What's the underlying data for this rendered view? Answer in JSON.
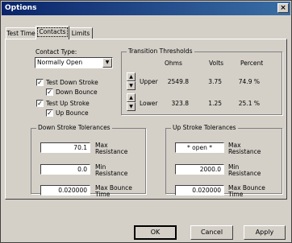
{
  "window": {
    "title": "Options",
    "close_label": "×"
  },
  "tabs": [
    {
      "label": "Test Time"
    },
    {
      "label": "Contacts"
    },
    {
      "label": "Limits"
    }
  ],
  "contact_type": {
    "label": "Contact Type:",
    "selected": "Normally Open",
    "checkboxes": [
      {
        "label": "Test Down Stroke",
        "checked": true
      },
      {
        "label": "Down Bounce",
        "checked": true
      },
      {
        "label": "Test Up Stroke",
        "checked": true
      },
      {
        "label": "Up Bounce",
        "checked": true
      }
    ]
  },
  "transition": {
    "title": "Transition Thresholds",
    "headers": {
      "ohms": "Ohms",
      "volts": "Volts",
      "percent": "Percent"
    },
    "rows": [
      {
        "label": "Upper",
        "ohms": "2549.8",
        "volts": "3.75",
        "percent": "74.9 %"
      },
      {
        "label": "Lower",
        "ohms": "323.8",
        "volts": "1.25",
        "percent": "25.1 %"
      }
    ]
  },
  "down_stroke": {
    "title": "Down Stroke Tolerances",
    "fields": [
      {
        "value": "70.1",
        "label1": "Max",
        "label2": "Resistance"
      },
      {
        "value": "0.0",
        "label1": "Min",
        "label2": "Resistance"
      },
      {
        "value": "0.020000",
        "label1": "Max Bounce",
        "label2": "Time"
      }
    ]
  },
  "up_stroke": {
    "title": "Up Stroke Tolerances",
    "fields": [
      {
        "value": "* open *",
        "label1": "Max",
        "label2": "Resistance"
      },
      {
        "value": "2000.0",
        "label1": "Min",
        "label2": "Resistance"
      },
      {
        "value": "0.020000",
        "label1": "Max Bounce",
        "label2": "Time"
      }
    ]
  },
  "buttons": {
    "ok": "OK",
    "cancel": "Cancel",
    "apply": "Apply"
  },
  "icons": {
    "checked": "✓",
    "dropdown": "▼",
    "spin_up": "▲",
    "spin_down": "▼"
  }
}
